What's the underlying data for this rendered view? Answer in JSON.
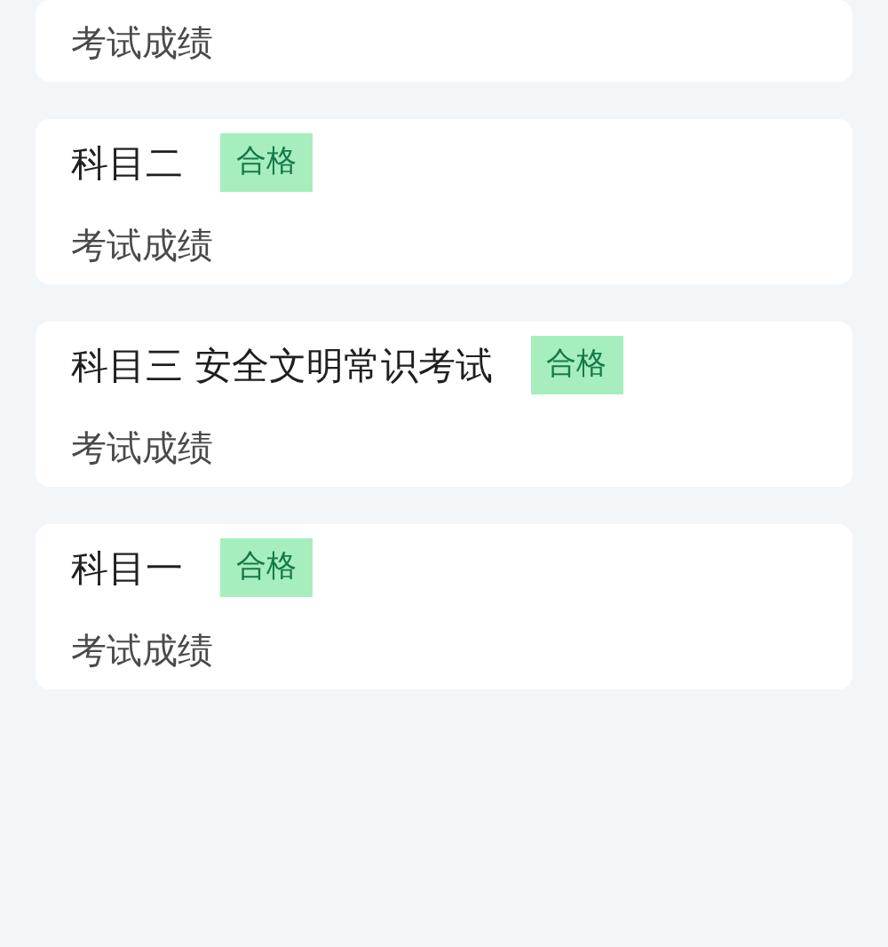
{
  "cards": [
    {
      "subtitle": "考试成绩"
    },
    {
      "title": "科目二",
      "badge": "合格",
      "subtitle": "考试成绩"
    },
    {
      "title": "科目三 安全文明常识考试",
      "badge": "合格",
      "subtitle": "考试成绩"
    },
    {
      "title": "科目一",
      "badge": "合格",
      "subtitle": "考试成绩"
    }
  ]
}
